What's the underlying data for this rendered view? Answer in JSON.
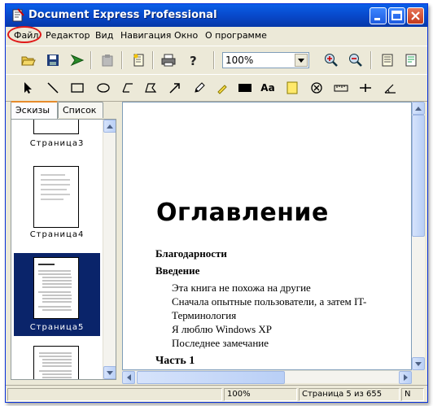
{
  "window": {
    "title": "Document Express Professional"
  },
  "menu": {
    "items": [
      "Файл",
      "Редактор",
      "Вид",
      "Навигация",
      "Окно",
      "О программе"
    ]
  },
  "toolbar": {
    "zoom_value": "100%"
  },
  "annotation_toolbar": {
    "text_tool_label": "Aa"
  },
  "left_panel": {
    "tabs": [
      "Эскизы",
      "Список"
    ],
    "thumbnails": [
      {
        "label": "Страница3"
      },
      {
        "label": "Страница4"
      },
      {
        "label": "Страница5",
        "selected": true
      },
      {
        "label": ""
      }
    ]
  },
  "document": {
    "heading": "Оглавление",
    "toc": [
      {
        "text": "Благодарности",
        "level": 1
      },
      {
        "text": "Введение",
        "level": 1
      },
      {
        "text": "Эта книга не похожа на другие",
        "level": 2
      },
      {
        "text": "Сначала опытные пользователи, а затем IT-",
        "level": 2
      },
      {
        "text": "Терминология",
        "level": 2
      },
      {
        "text": "Я люблю Windows XP",
        "level": 2
      },
      {
        "text": "Последнее замечание",
        "level": 2
      },
      {
        "text": "Часть 1",
        "level": 0
      }
    ]
  },
  "status": {
    "zoom": "100%",
    "page_info": "Страница 5 из 655",
    "extra": "N"
  }
}
